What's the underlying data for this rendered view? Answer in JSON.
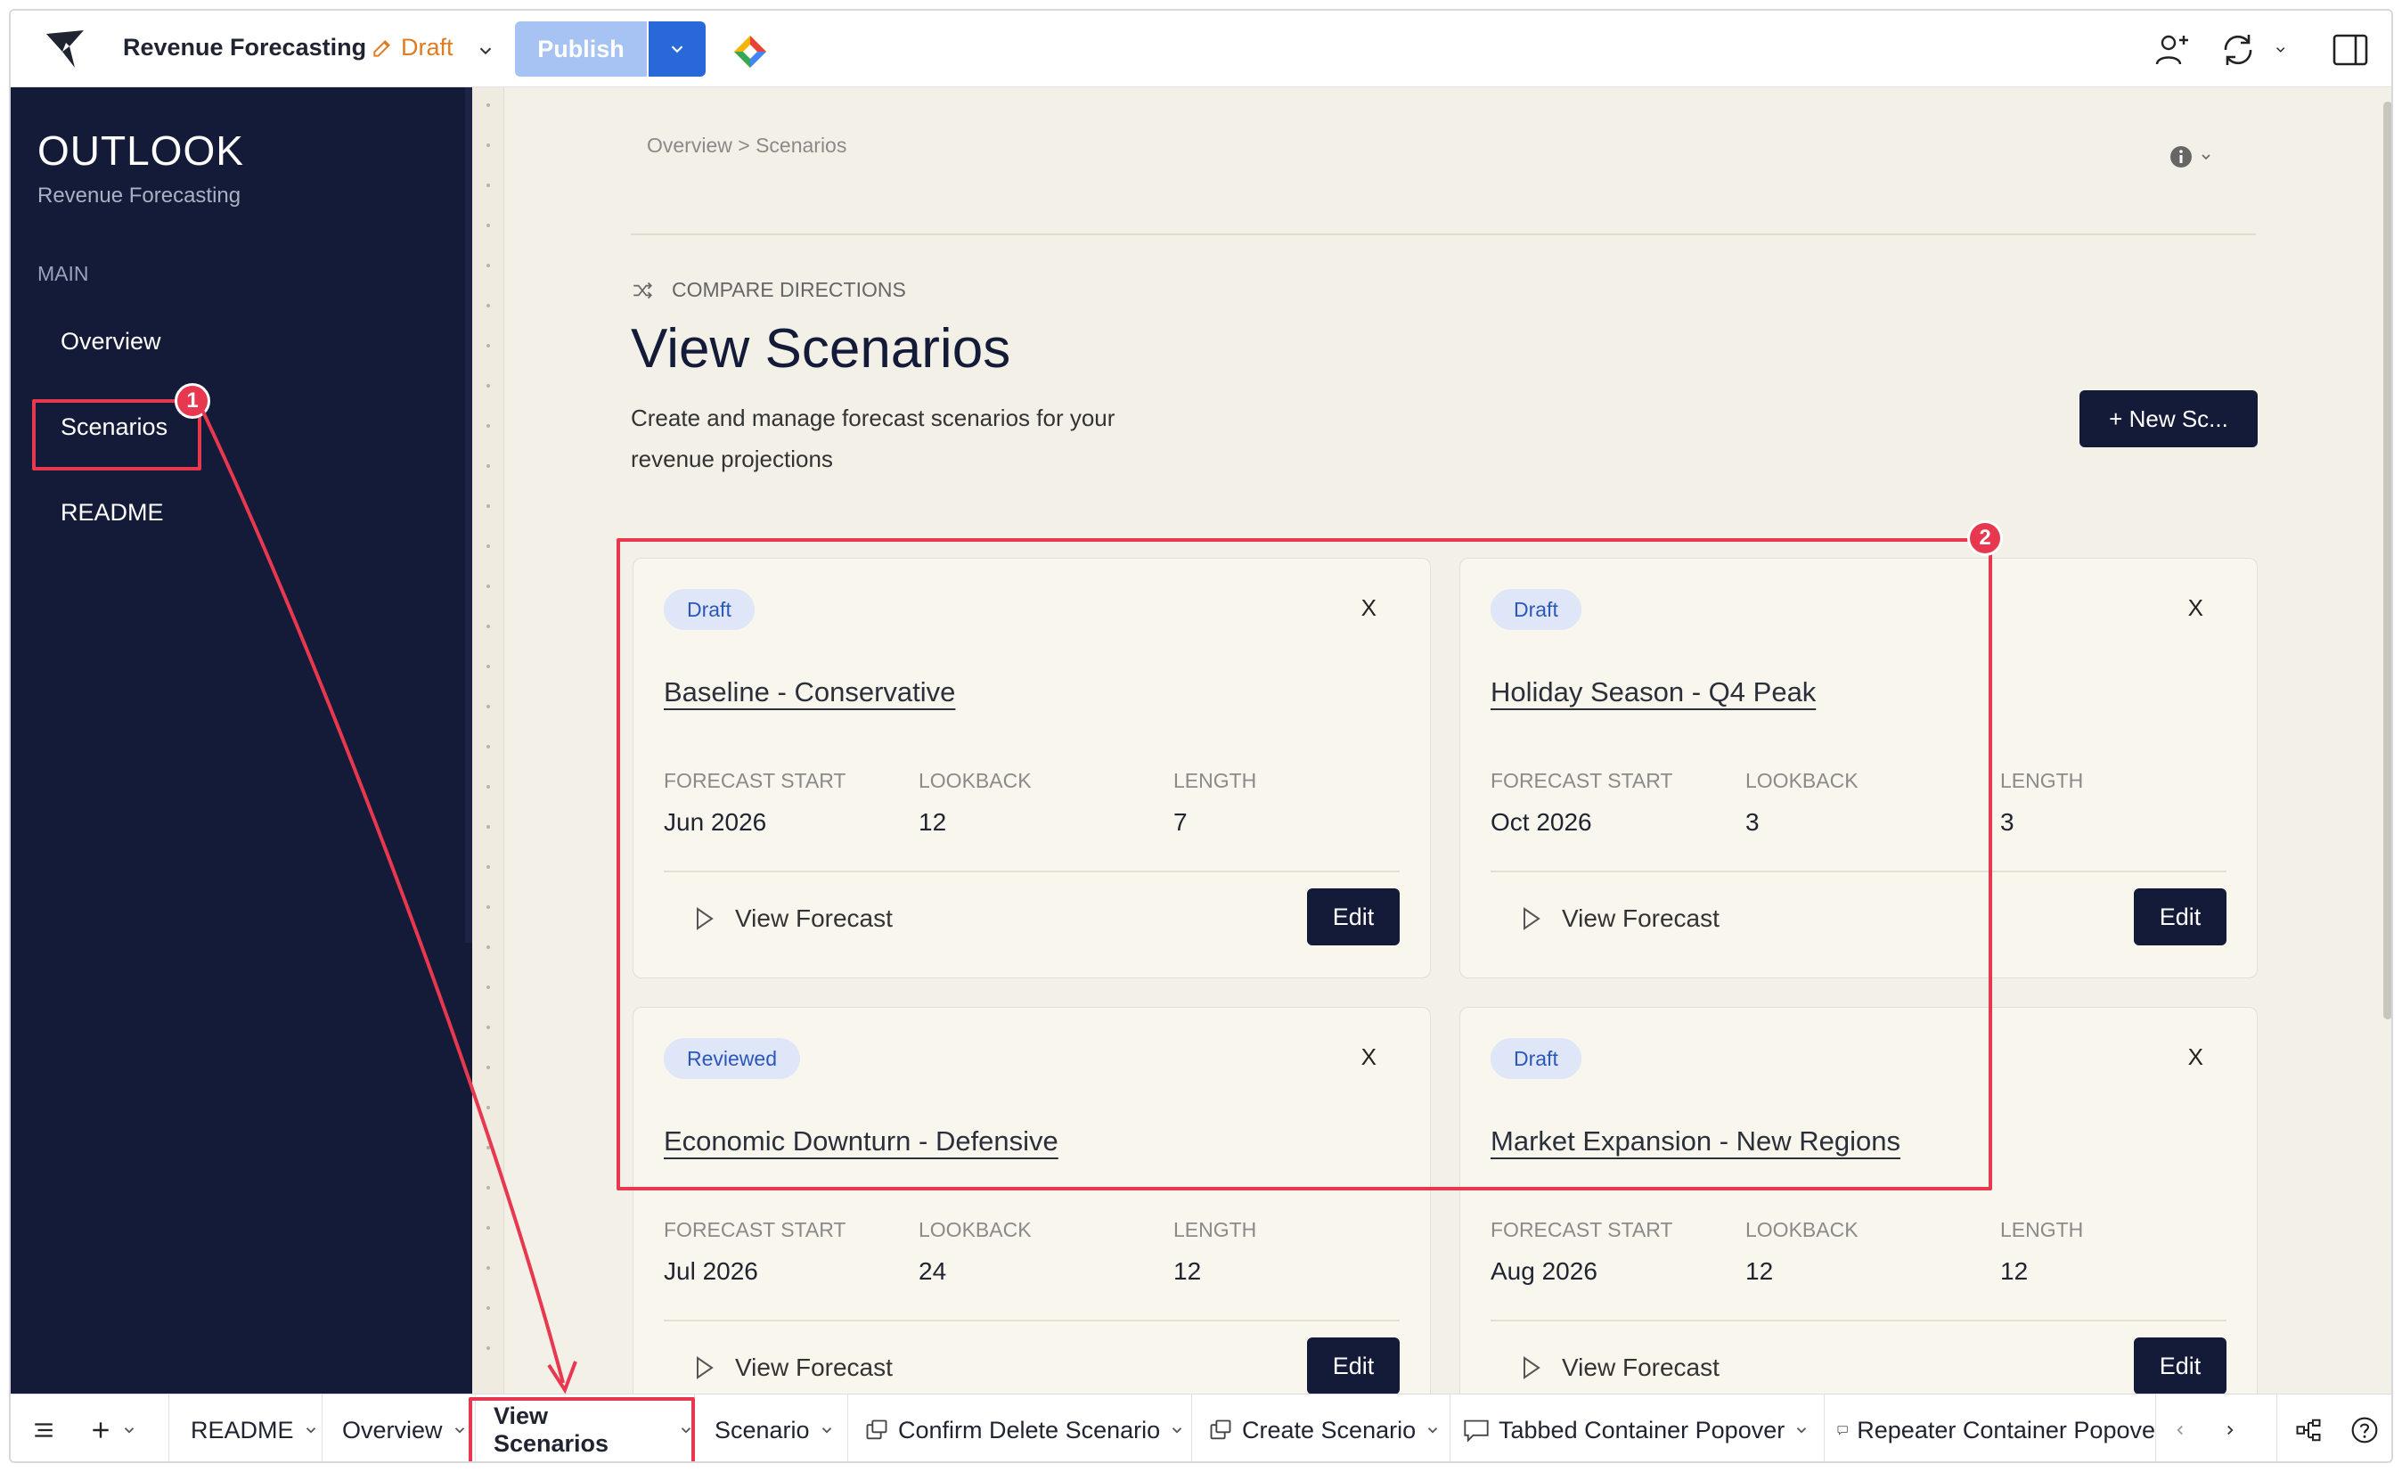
{
  "topbar": {
    "app_title": "Revenue Forecasting",
    "status": "Draft",
    "publish_label": "Publish"
  },
  "sidebar": {
    "brand_title": "OUTLOOK",
    "brand_subtitle": "Revenue Forecasting",
    "section_label": "MAIN",
    "items": [
      {
        "label": "Overview"
      },
      {
        "label": "Scenarios"
      },
      {
        "label": "README"
      }
    ]
  },
  "main": {
    "breadcrumb": "Overview > Scenarios",
    "eyebrow": "COMPARE DIRECTIONS",
    "title": "View Scenarios",
    "description": "Create and manage forecast scenarios for your revenue projections",
    "new_button": "+ New Sc..."
  },
  "card_labels": {
    "forecast_start": "FORECAST START",
    "lookback": "LOOKBACK",
    "length": "LENGTH",
    "view_forecast": "View Forecast",
    "edit": "Edit",
    "close": "X"
  },
  "scenarios": [
    {
      "status": "Draft",
      "name": "Baseline - Conservative",
      "forecast_start": "Jun 2026",
      "lookback": "12",
      "length": "7"
    },
    {
      "status": "Draft",
      "name": "Holiday Season - Q4 Peak",
      "forecast_start": "Oct 2026",
      "lookback": "3",
      "length": "3"
    },
    {
      "status": "Reviewed",
      "name": "Economic Downturn - Defensive",
      "forecast_start": "Jul 2026",
      "lookback": "24",
      "length": "12"
    },
    {
      "status": "Draft",
      "name": "Market Expansion - New Regions",
      "forecast_start": "Aug 2026",
      "lookback": "12",
      "length": "12"
    }
  ],
  "bottom_tabs": [
    {
      "label": "README"
    },
    {
      "label": "Overview"
    },
    {
      "label": "View Scenarios"
    },
    {
      "label": "Scenario"
    },
    {
      "label": "Confirm Delete Scenario"
    },
    {
      "label": "Create Scenario"
    },
    {
      "label": "Tabbed Container Popover"
    },
    {
      "label": "Repeater Container Popove"
    }
  ],
  "annotations": {
    "marker_1": "1",
    "marker_2": "2"
  },
  "colors": {
    "sidebar_bg": "#141b38",
    "main_bg": "#f3f0e7",
    "accent_blue": "#2868d8",
    "draft_orange": "#e07b1f",
    "annotation_red": "#e8384f"
  }
}
